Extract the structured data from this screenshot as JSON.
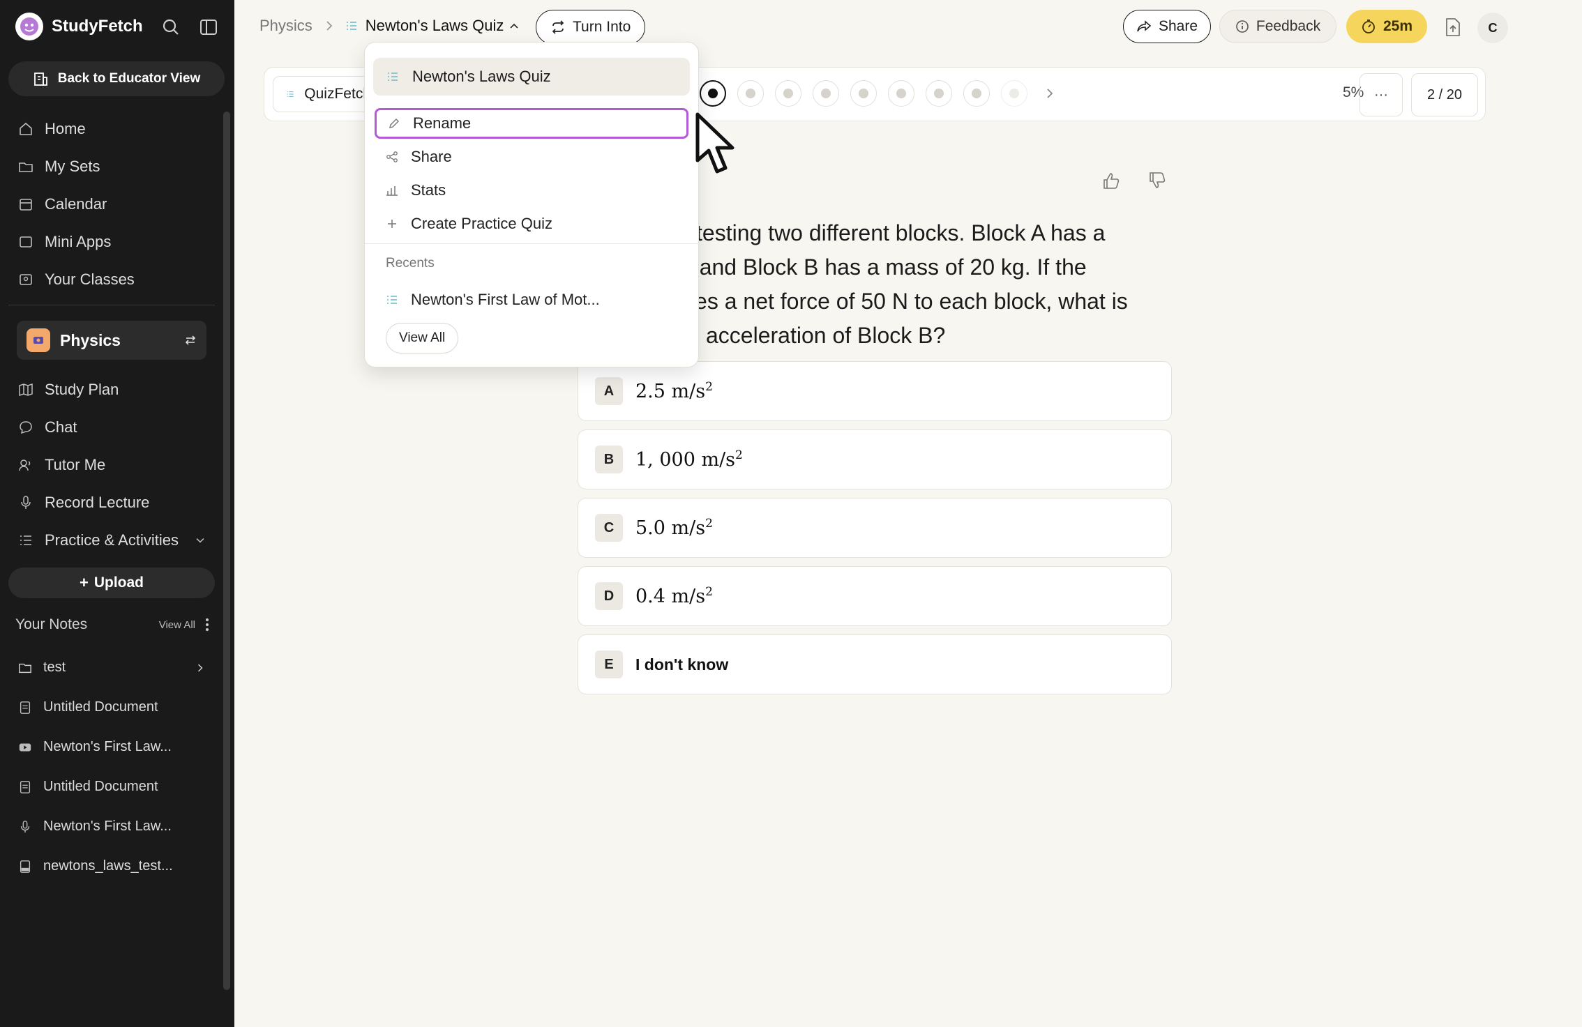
{
  "app": {
    "name": "StudyFetch"
  },
  "sidebar": {
    "educator_button": "Back to Educator View",
    "nav": [
      {
        "label": "Home",
        "icon": "home-icon"
      },
      {
        "label": "My Sets",
        "icon": "folder-icon"
      },
      {
        "label": "Calendar",
        "icon": "calendar-icon"
      },
      {
        "label": "Mini Apps",
        "icon": "window-icon"
      },
      {
        "label": "Your Classes",
        "icon": "classes-icon"
      }
    ],
    "current_class": "Physics",
    "class_nav": [
      {
        "label": "Study Plan",
        "icon": "map-icon"
      },
      {
        "label": "Chat",
        "icon": "chat-icon"
      },
      {
        "label": "Tutor Me",
        "icon": "tutor-icon"
      },
      {
        "label": "Record Lecture",
        "icon": "mic-icon"
      },
      {
        "label": "Practice & Activities",
        "icon": "list-icon"
      }
    ],
    "upload_label": "Upload",
    "notes_title": "Your Notes",
    "notes_view_all": "View All",
    "notes": [
      {
        "label": "test",
        "icon": "folder-icon"
      },
      {
        "label": "Untitled Document",
        "icon": "document-icon"
      },
      {
        "label": "Newton's First Law...",
        "icon": "youtube-icon"
      },
      {
        "label": "Untitled Document",
        "icon": "document-icon"
      },
      {
        "label": "Newton's First Law...",
        "icon": "mic-icon"
      },
      {
        "label": "newtons_laws_test...",
        "icon": "pdf-icon"
      }
    ]
  },
  "topbar": {
    "breadcrumb_root": "Physics",
    "breadcrumb_current": "Newton's Laws Quiz",
    "turn_into": "Turn Into",
    "share": "Share",
    "feedback": "Feedback",
    "timer": "25m",
    "avatar_initial": "C"
  },
  "quiz": {
    "mode_label": "QuizFetch",
    "progress_percent": "5%",
    "progress_fraction": 0.05,
    "current_question": 2,
    "counter": "2 / 20",
    "more": "···",
    "question_lines": [
      "is testing two different blocks. Block A has a",
      "g and Block B has a mass of 20 kg. If the",
      "plies a net force of 50 N to each block, what is",
      "acceleration of Block B?"
    ],
    "options": [
      {
        "letter": "A",
        "value": "2.5 m/s",
        "exp": "2"
      },
      {
        "letter": "B",
        "value": "1, 000 m/s",
        "exp": "2"
      },
      {
        "letter": "C",
        "value": "5.0 m/s",
        "exp": "2"
      },
      {
        "letter": "D",
        "value": "0.4 m/s",
        "exp": "2"
      },
      {
        "letter": "E",
        "value": "I don't know",
        "exp": ""
      }
    ]
  },
  "dropdown": {
    "current": "Newton's Laws Quiz",
    "items": [
      {
        "label": "Rename",
        "icon": "pencil-icon"
      },
      {
        "label": "Share",
        "icon": "share-nodes-icon"
      },
      {
        "label": "Stats",
        "icon": "bar-chart-icon"
      },
      {
        "label": "Create Practice Quiz",
        "icon": "plus-icon"
      }
    ],
    "recents_label": "Recents",
    "recent_item": "Newton's First Law of Mot...",
    "view_all": "View All"
  },
  "colors": {
    "sidebar_bg": "#1a1a1a",
    "page_bg": "#f7f6f1",
    "timer_bg": "#f6d55c",
    "focus_ring": "#b55ad7"
  }
}
